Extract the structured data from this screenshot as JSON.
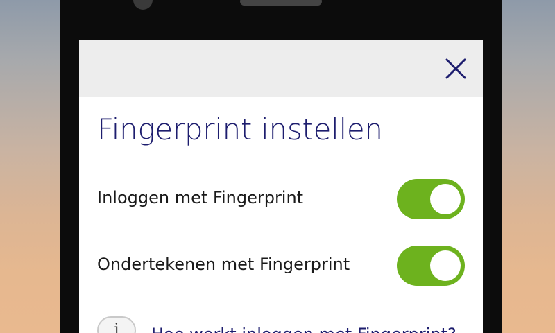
{
  "dialog": {
    "title": "Fingerprint instellen",
    "close_icon": "close-icon"
  },
  "settings": [
    {
      "label": "Inloggen met Fingerprint",
      "enabled": true
    },
    {
      "label": "Ondertekenen met Fingerprint",
      "enabled": true
    }
  ],
  "info": {
    "icon": "info-icon",
    "icon_glyph": "i",
    "link_text": "Hoe werkt inloggen met Fingerprint?"
  },
  "colors": {
    "title": "#1d1d6e",
    "toggle_on": "#6db21e",
    "close_icon": "#1d1d6e"
  }
}
